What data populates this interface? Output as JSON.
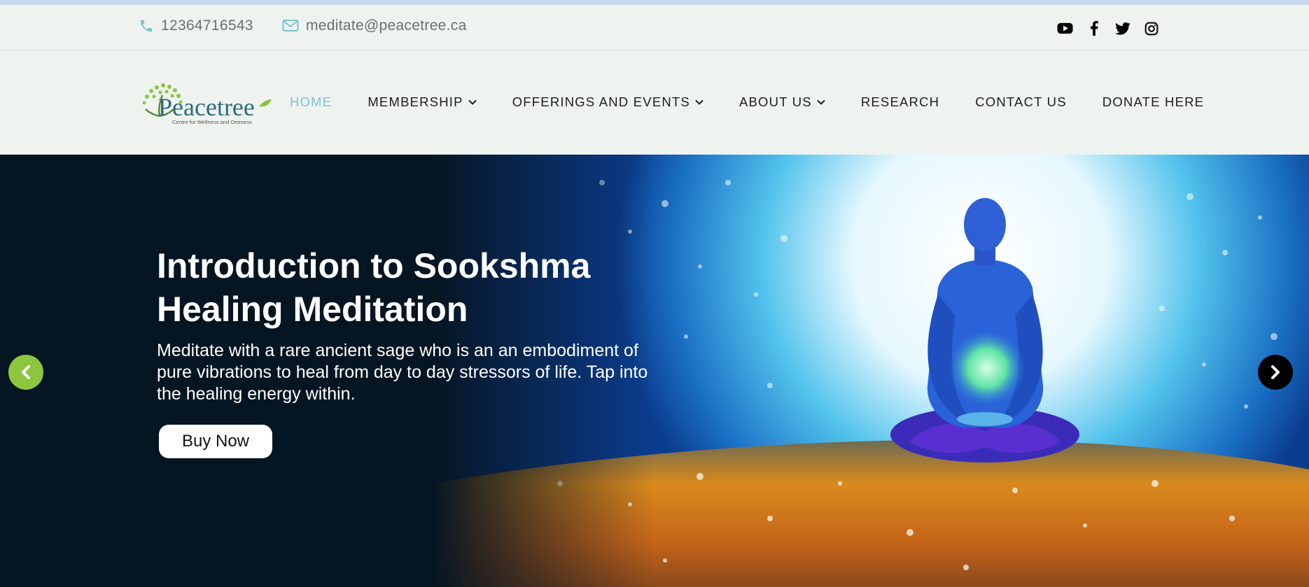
{
  "topbar": {
    "phone": "12364716543",
    "email": "meditate@peacetree.ca",
    "socials": [
      "youtube-icon",
      "facebook-icon",
      "twitter-icon",
      "instagram-icon"
    ]
  },
  "logo": {
    "name": "Peacetree",
    "tagline": "Centre for Wellness and Oneness"
  },
  "nav": {
    "items": [
      {
        "label": "HOME",
        "active": true,
        "dropdown": false
      },
      {
        "label": "MEMBERSHIP",
        "active": false,
        "dropdown": true
      },
      {
        "label": "OFFERINGS AND EVENTS",
        "active": false,
        "dropdown": true
      },
      {
        "label": "ABOUT US",
        "active": false,
        "dropdown": true
      },
      {
        "label": "RESEARCH",
        "active": false,
        "dropdown": false
      },
      {
        "label": "CONTACT US",
        "active": false,
        "dropdown": false
      },
      {
        "label": "DONATE HERE",
        "active": false,
        "dropdown": false
      }
    ]
  },
  "hero": {
    "title": "Introduction to Sookshma Healing Meditation",
    "subtitle": "Meditate with a rare ancient sage who is an an embodiment of pure vibrations to heal from day to day stressors of life. Tap into the healing energy within.",
    "button": "Buy Now",
    "prev_icon": "chevron-left-icon",
    "next_icon": "chevron-right-icon"
  },
  "colors": {
    "accent_active": "#7cc3cf",
    "prev_arrow": "#8cc63f",
    "next_arrow": "#000000",
    "hero_dark": "#061522"
  }
}
